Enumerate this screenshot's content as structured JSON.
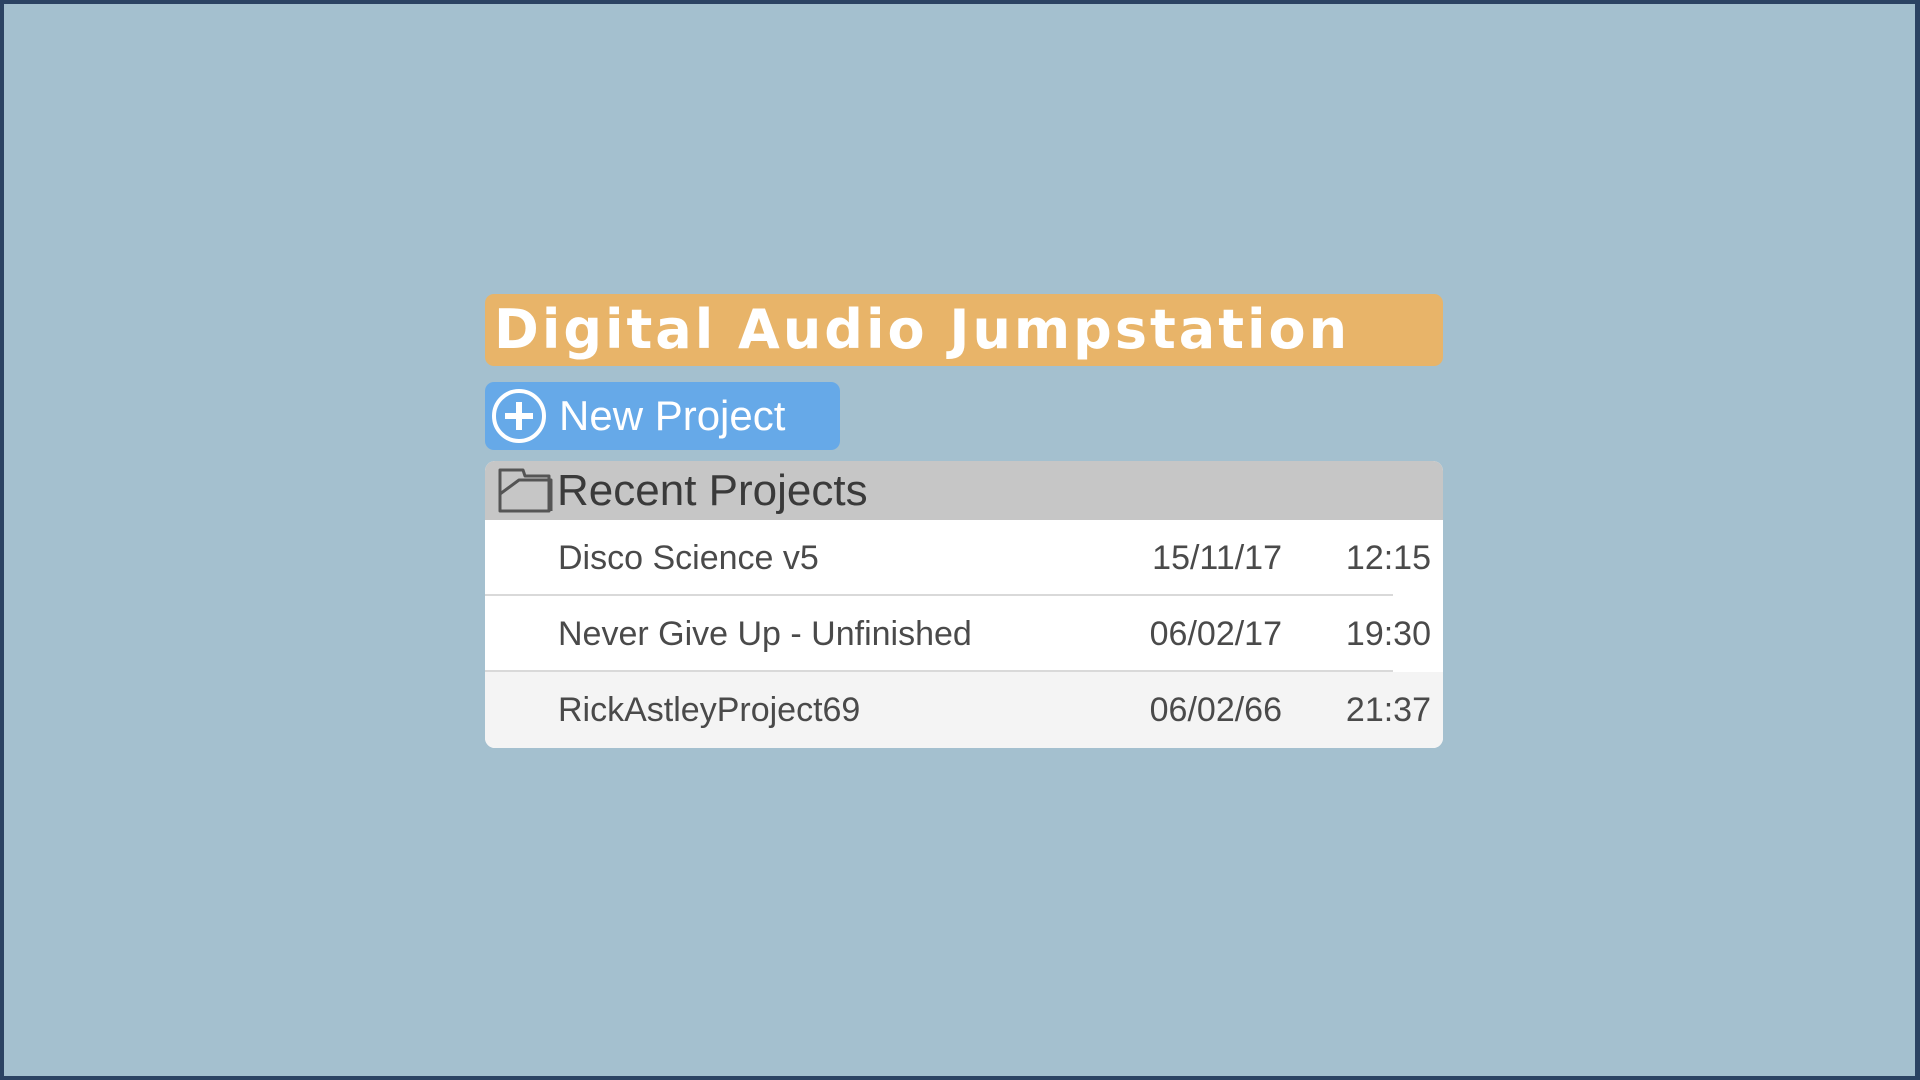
{
  "app": {
    "title": "Digital Audio Jumpstation"
  },
  "actions": {
    "new_project_label": "New Project",
    "new_project_icon": "plus-circle-icon"
  },
  "recent": {
    "title": "Recent Projects",
    "icon": "folder-icon",
    "projects": [
      {
        "name": "Disco Science v5",
        "date": "15/11/17",
        "time": "12:15"
      },
      {
        "name": "Never Give Up - Unfinished",
        "date": "06/02/17",
        "time": "19:30"
      },
      {
        "name": "RickAstleyProject69",
        "date": "06/02/66",
        "time": "21:37"
      }
    ]
  },
  "colors": {
    "background": "#a4c0cf",
    "border": "#2b4363",
    "title_bar": "#e8b469",
    "primary_button": "#66a9e8",
    "list_header": "#c6c6c6"
  }
}
